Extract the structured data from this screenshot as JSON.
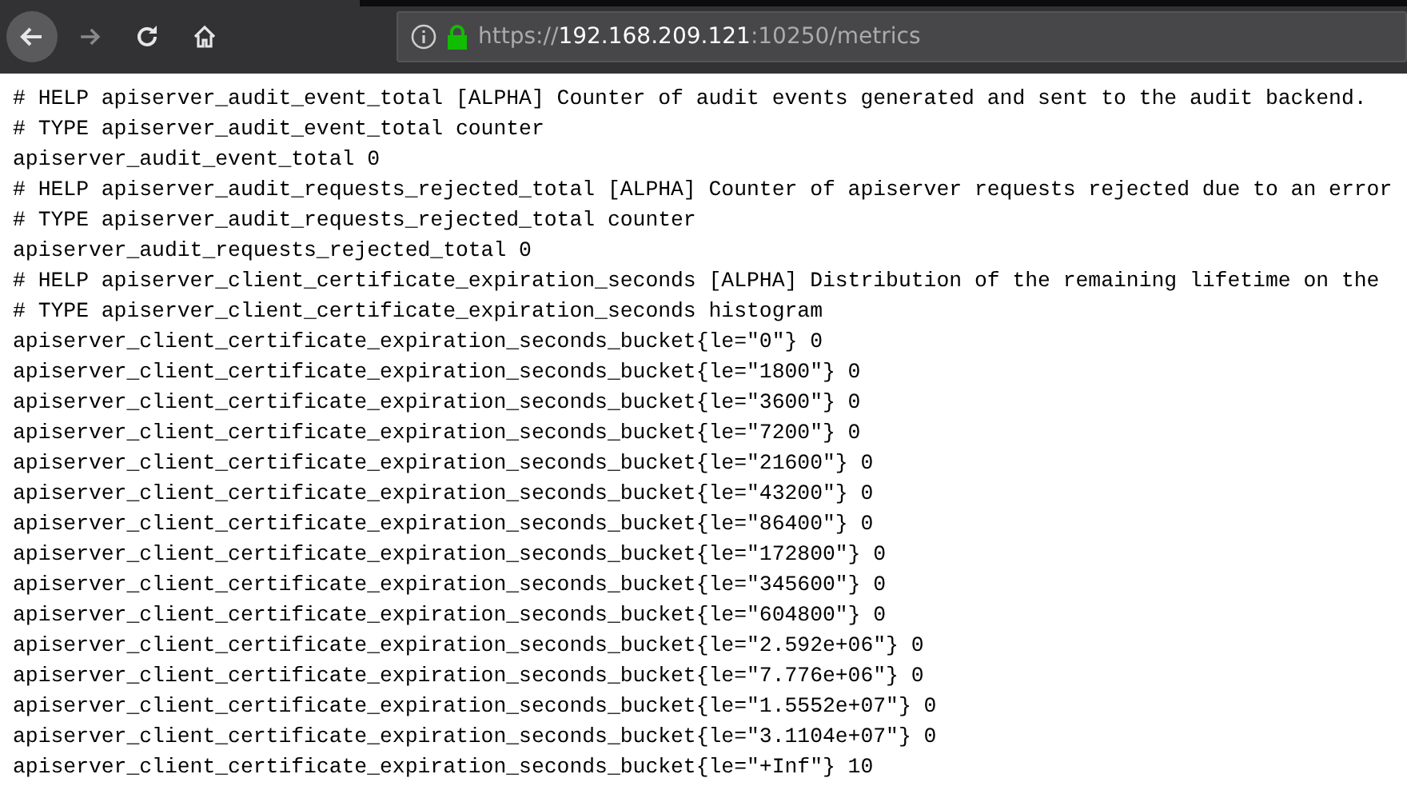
{
  "toolbar": {
    "url_scheme": "https://",
    "url_host": "192.168.209.121",
    "url_path": ":10250/metrics",
    "back_disabled": false,
    "forward_disabled": true
  },
  "lines": [
    "# HELP apiserver_audit_event_total [ALPHA] Counter of audit events generated and sent to the audit backend.",
    "# TYPE apiserver_audit_event_total counter",
    "apiserver_audit_event_total 0",
    "# HELP apiserver_audit_requests_rejected_total [ALPHA] Counter of apiserver requests rejected due to an error",
    "# TYPE apiserver_audit_requests_rejected_total counter",
    "apiserver_audit_requests_rejected_total 0",
    "# HELP apiserver_client_certificate_expiration_seconds [ALPHA] Distribution of the remaining lifetime on the",
    "# TYPE apiserver_client_certificate_expiration_seconds histogram",
    "apiserver_client_certificate_expiration_seconds_bucket{le=\"0\"} 0",
    "apiserver_client_certificate_expiration_seconds_bucket{le=\"1800\"} 0",
    "apiserver_client_certificate_expiration_seconds_bucket{le=\"3600\"} 0",
    "apiserver_client_certificate_expiration_seconds_bucket{le=\"7200\"} 0",
    "apiserver_client_certificate_expiration_seconds_bucket{le=\"21600\"} 0",
    "apiserver_client_certificate_expiration_seconds_bucket{le=\"43200\"} 0",
    "apiserver_client_certificate_expiration_seconds_bucket{le=\"86400\"} 0",
    "apiserver_client_certificate_expiration_seconds_bucket{le=\"172800\"} 0",
    "apiserver_client_certificate_expiration_seconds_bucket{le=\"345600\"} 0",
    "apiserver_client_certificate_expiration_seconds_bucket{le=\"604800\"} 0",
    "apiserver_client_certificate_expiration_seconds_bucket{le=\"2.592e+06\"} 0",
    "apiserver_client_certificate_expiration_seconds_bucket{le=\"7.776e+06\"} 0",
    "apiserver_client_certificate_expiration_seconds_bucket{le=\"1.5552e+07\"} 0",
    "apiserver_client_certificate_expiration_seconds_bucket{le=\"3.1104e+07\"} 0",
    "apiserver_client_certificate_expiration_seconds_bucket{le=\"+Inf\"} 10"
  ]
}
